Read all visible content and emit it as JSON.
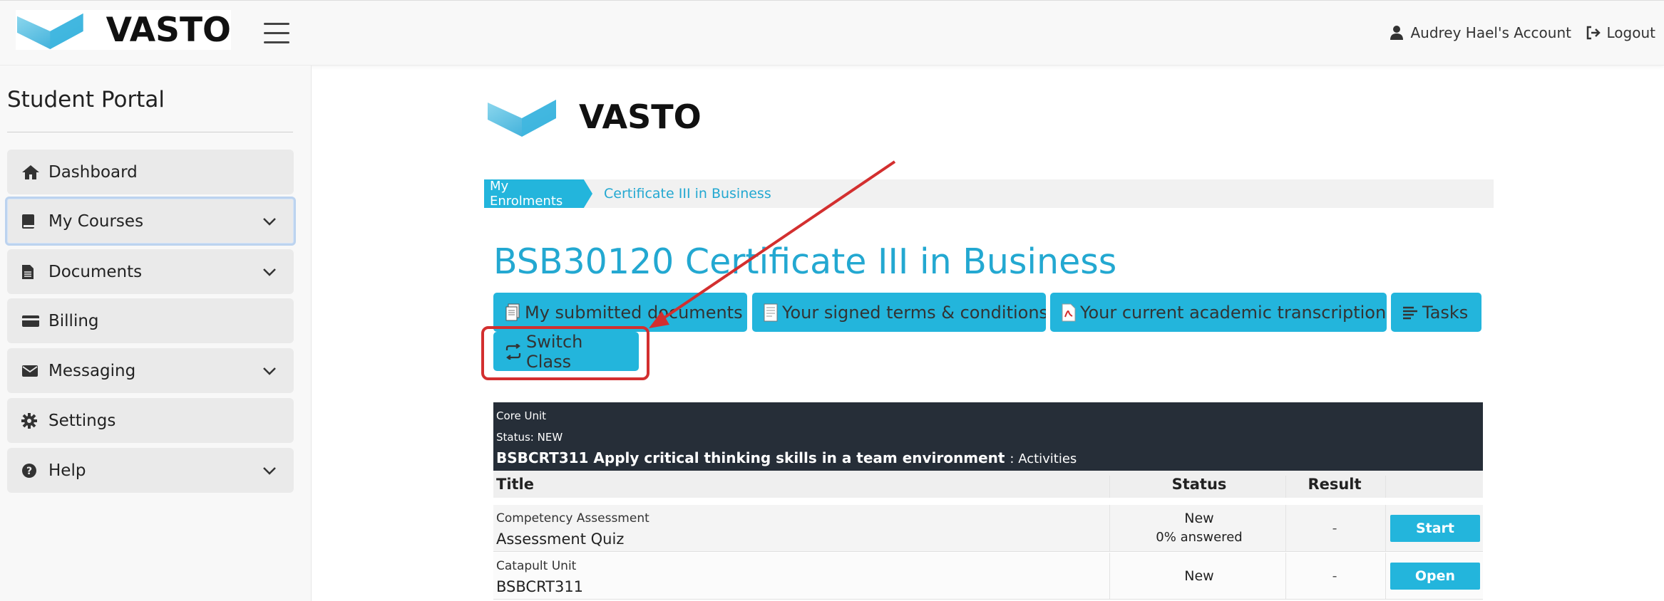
{
  "brand": {
    "name": "VASTO"
  },
  "header": {
    "account_label": "Audrey Hael's Account",
    "logout_label": "Logout"
  },
  "sidebar": {
    "title": "Student Portal",
    "items": [
      {
        "label": "Dashboard",
        "icon": "home-icon",
        "has_dropdown": false
      },
      {
        "label": "My Courses",
        "icon": "book-icon",
        "has_dropdown": true,
        "active": true
      },
      {
        "label": "Documents",
        "icon": "file-icon",
        "has_dropdown": true
      },
      {
        "label": "Billing",
        "icon": "credit-card-icon",
        "has_dropdown": false
      },
      {
        "label": "Messaging",
        "icon": "envelope-icon",
        "has_dropdown": true
      },
      {
        "label": "Settings",
        "icon": "gear-icon",
        "has_dropdown": false
      },
      {
        "label": "Help",
        "icon": "question-circle-icon",
        "has_dropdown": true
      }
    ]
  },
  "breadcrumb": {
    "root": "My Enrolments",
    "current": "Certificate III in Business"
  },
  "page": {
    "title": "BSB30120 Certificate III in Business"
  },
  "actions": {
    "submitted_docs": "My submitted documents",
    "terms": "Your signed terms & conditions",
    "transcript": "Your current academic transcription",
    "tasks": "Tasks",
    "switch_class": "Switch Class"
  },
  "unit": {
    "category": "Core Unit",
    "status": "Status: NEW",
    "title": "BSBCRT311 Apply critical thinking skills in a team environment",
    "title_suffix": ": Activities",
    "columns": {
      "title": "Title",
      "status": "Status",
      "result": "Result"
    },
    "rows": [
      {
        "type": "Competency Assessment",
        "name": "Assessment Quiz",
        "status": "New",
        "status_detail": "0% answered",
        "result": "-",
        "action": "Start"
      },
      {
        "type": "Catapult Unit",
        "name": "BSBCRT311",
        "status": "New",
        "status_detail": "",
        "result": "-",
        "action": "Open"
      }
    ]
  },
  "colors": {
    "accent": "#23b5dc",
    "title": "#23a8d1",
    "dark_header": "#262e38",
    "annotation": "#d32f2f"
  }
}
